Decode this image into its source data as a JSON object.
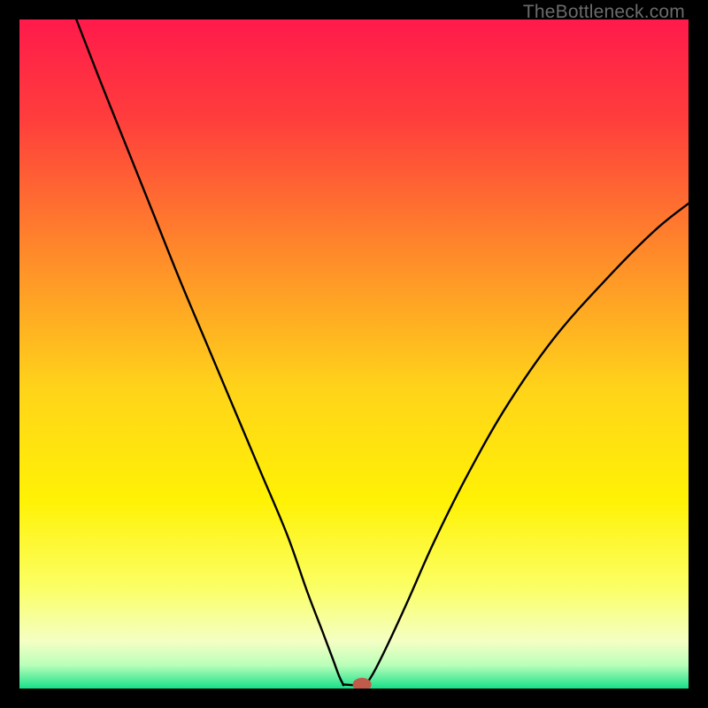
{
  "watermark": "TheBottleneck.com",
  "chart_data": {
    "type": "line",
    "title": "",
    "xlabel": "",
    "ylabel": "",
    "xlim": [
      0,
      100
    ],
    "ylim": [
      0,
      100
    ],
    "grid": false,
    "legend": false,
    "background_gradient_stops": [
      {
        "offset": 0.0,
        "color": "#ff1a4b"
      },
      {
        "offset": 0.15,
        "color": "#ff3e3c"
      },
      {
        "offset": 0.35,
        "color": "#ff8a2a"
      },
      {
        "offset": 0.55,
        "color": "#ffd31a"
      },
      {
        "offset": 0.72,
        "color": "#fff205"
      },
      {
        "offset": 0.85,
        "color": "#fbff66"
      },
      {
        "offset": 0.93,
        "color": "#f4ffc4"
      },
      {
        "offset": 0.965,
        "color": "#b9ffb9"
      },
      {
        "offset": 1.0,
        "color": "#18e08a"
      }
    ],
    "series": [
      {
        "name": "left-branch",
        "x": [
          8.5,
          12,
          16,
          20,
          24,
          28,
          32,
          36,
          40,
          43,
          45.3,
          46.8,
          47.8,
          48.4
        ],
        "y": [
          100,
          91,
          81,
          71,
          61,
          51.5,
          42,
          32.5,
          23,
          14.5,
          8.5,
          4.5,
          1.8,
          0.6
        ]
      },
      {
        "name": "valley-flat",
        "x": [
          48.4,
          49.2,
          50.2,
          51.0,
          51.8
        ],
        "y": [
          0.6,
          0.55,
          0.5,
          0.5,
          0.6
        ]
      },
      {
        "name": "right-branch",
        "x": [
          51.8,
          53,
          55,
          58,
          62,
          67,
          73,
          80,
          88,
          95,
          100
        ],
        "y": [
          0.6,
          2.5,
          6.5,
          13,
          22,
          32,
          42.5,
          52.5,
          61.5,
          68.5,
          72.5
        ]
      }
    ],
    "marker": {
      "name": "valley-marker",
      "x": 51.2,
      "y": 0.6,
      "color": "#c05a4a",
      "rx": 1.4,
      "ry": 1.0
    }
  }
}
